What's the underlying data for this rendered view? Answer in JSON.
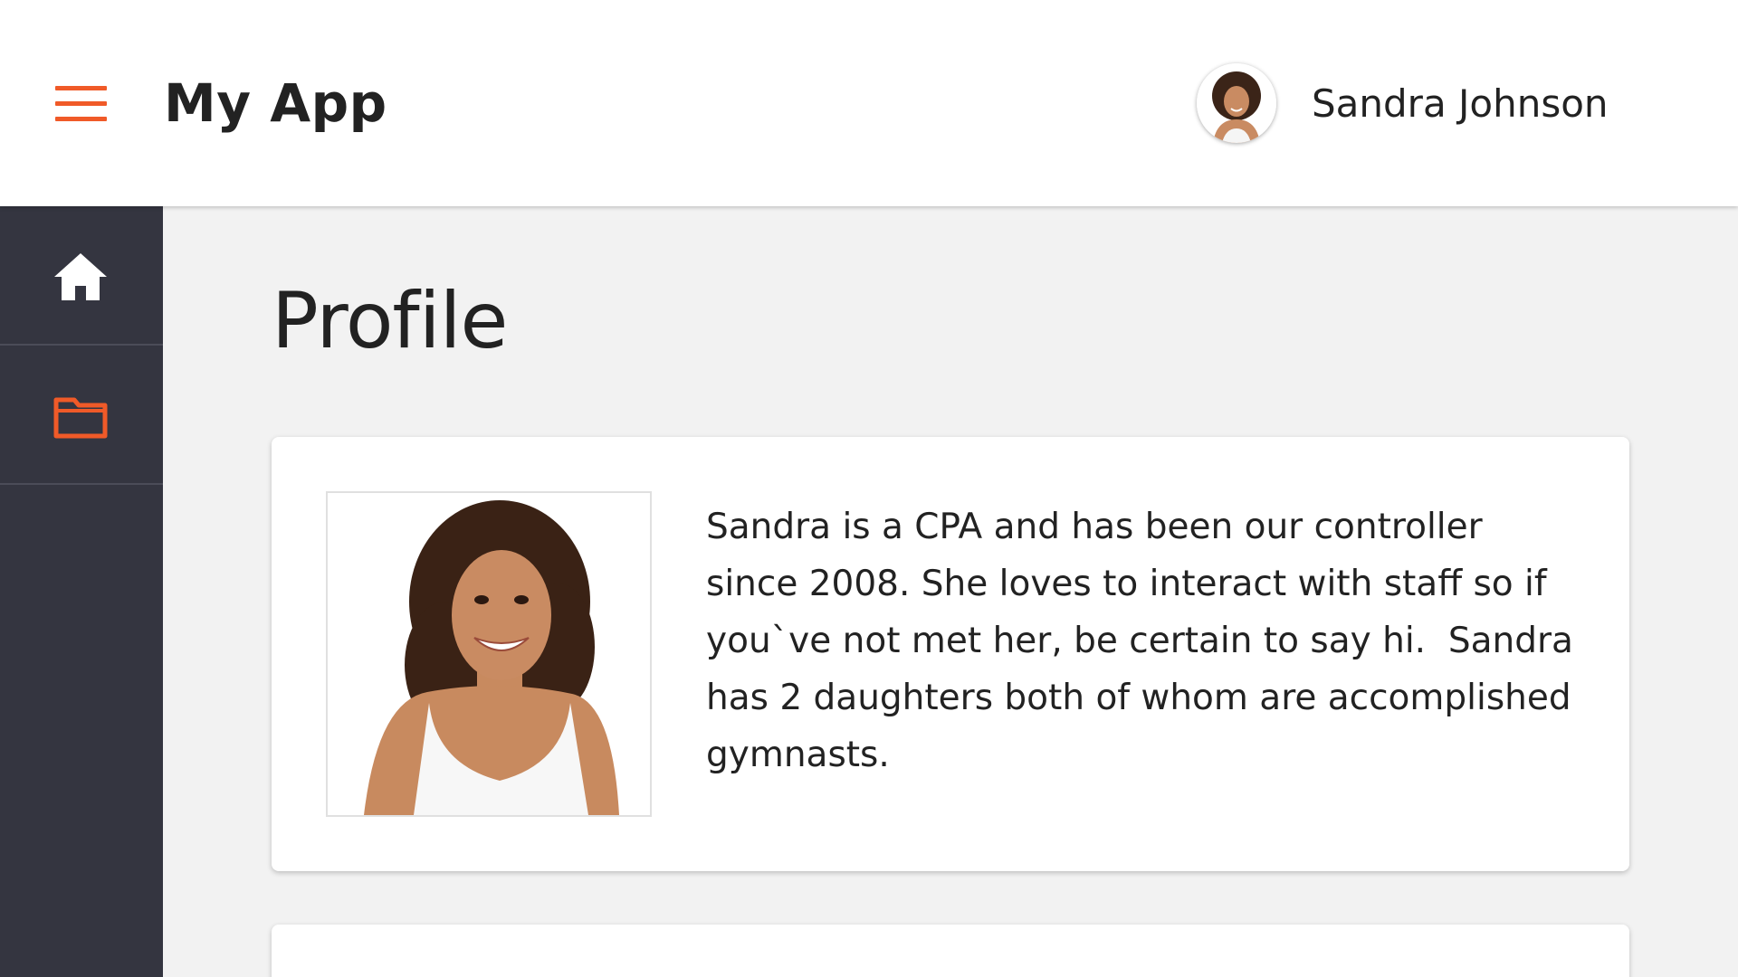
{
  "header": {
    "menu_icon": "hamburger-menu-icon",
    "app_title": "My App",
    "user": {
      "name": "Sandra Johnson",
      "avatar": "user-avatar-photo"
    }
  },
  "sidebar": {
    "items": [
      {
        "icon": "home-icon",
        "color": "#ffffff"
      },
      {
        "icon": "folder-icon",
        "color": "#f05a28"
      }
    ]
  },
  "main": {
    "title": "Profile",
    "profile_card": {
      "photo": "profile-photo",
      "bio": "Sandra is a CPA and has been our controller since 2008. She loves to interact with staff so if you`ve not met her, be certain to say hi.  Sandra has 2 daughters both of whom are accomplished gymnasts."
    }
  },
  "colors": {
    "accent": "#f05a28",
    "sidebar_bg": "#343540",
    "content_bg": "#f2f2f2",
    "header_bg": "#ffffff"
  }
}
